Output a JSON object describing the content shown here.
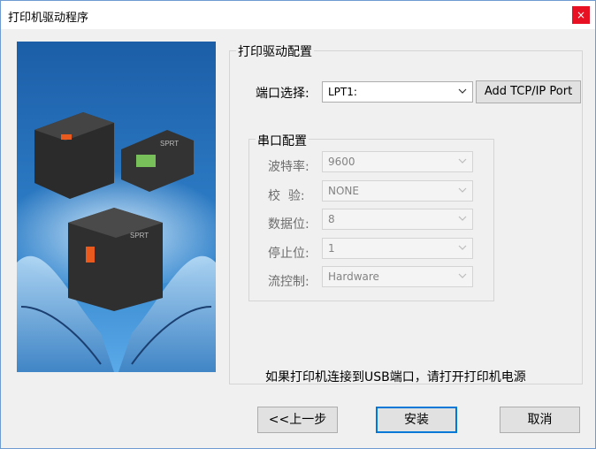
{
  "window": {
    "title": "打印机驱动程序",
    "close_symbol": "×"
  },
  "driver_group": {
    "title": "打印驱动配置",
    "port_label": "端口选择:",
    "port_value": "LPT1:",
    "add_port_button": "Add TCP/IP Port"
  },
  "serial_group": {
    "title": "串口配置",
    "fields": [
      {
        "label": "波特率:",
        "value": "9600"
      },
      {
        "label": "校  验:",
        "value": "NONE"
      },
      {
        "label": "数据位:",
        "value": "8"
      },
      {
        "label": "停止位:",
        "value": "1"
      },
      {
        "label": "流控制:",
        "value": "Hardware"
      }
    ]
  },
  "notice": "如果打印机连接到USB端口，请打开打印机电源",
  "buttons": {
    "back": "<<上一步",
    "install": "安装",
    "cancel": "取消"
  },
  "banner": {
    "brand_text": "SPRT"
  },
  "colors": {
    "accent": "#0078d7",
    "close_red": "#e81123"
  }
}
